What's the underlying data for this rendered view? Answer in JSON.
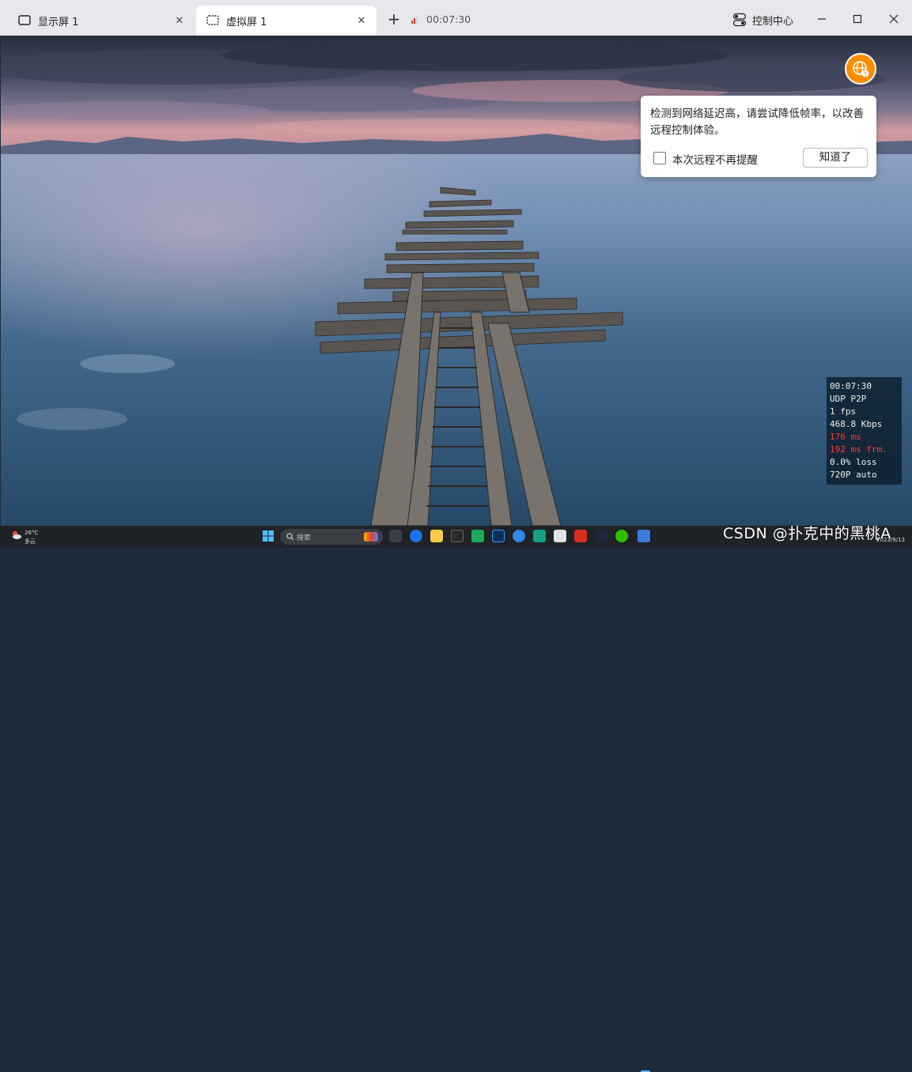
{
  "tabs": [
    {
      "label": "显示屏 1",
      "icon": "monitor-icon",
      "active": false
    },
    {
      "label": "虚拟屏 1",
      "icon": "virtual-screen-icon",
      "active": true
    }
  ],
  "session": {
    "elapsed": "00:07:30",
    "signal_color": "#e0342e"
  },
  "control_center_label": "控制中心",
  "notification": {
    "message": "检测到网络延迟高，请尝试降低帧率，以改善远程控制体验。",
    "checkbox_label": "本次远程不再提醒",
    "button_label": "知道了",
    "badge_color": "#fb8c00"
  },
  "stats": {
    "lines": [
      {
        "text": "00:07:30",
        "alert": false
      },
      {
        "text": "UDP P2P",
        "alert": false
      },
      {
        "text": "1 fps",
        "alert": false
      },
      {
        "text": "468.8 Kbps",
        "alert": false
      },
      {
        "text": "176 ms",
        "alert": true
      },
      {
        "text": "192 ms frm.",
        "alert": true
      },
      {
        "text": "0.0% loss",
        "alert": false
      },
      {
        "text": "720P auto",
        "alert": false
      }
    ]
  },
  "taskbar": {
    "weather_temp": "26°C",
    "weather_desc": "多云",
    "search_placeholder": "搜索",
    "date": "2023/9/13"
  },
  "watermark": "CSDN @扑克中的黑桃A"
}
